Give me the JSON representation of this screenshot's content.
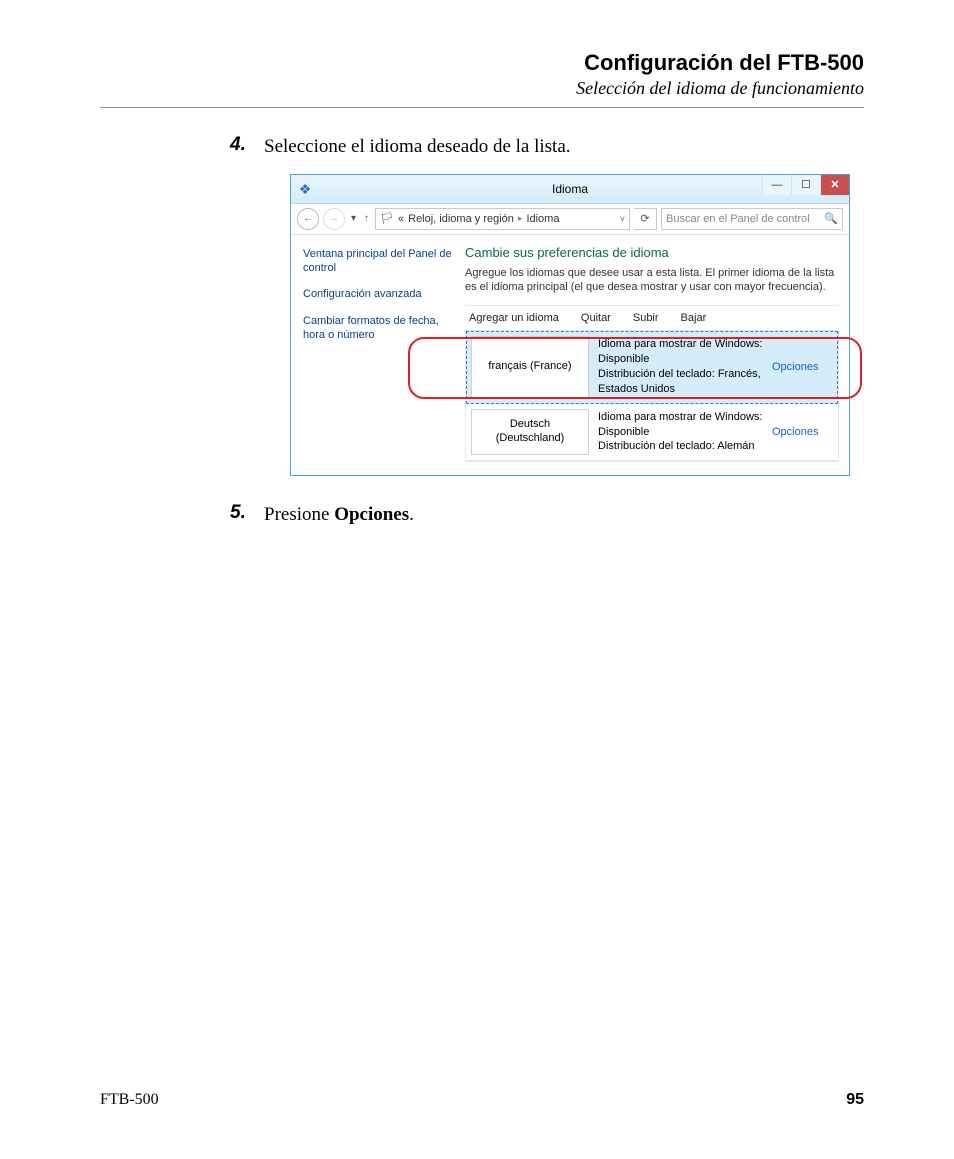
{
  "header": {
    "title": "Configuración del FTB-500",
    "subtitle": "Selección del idioma de funcionamiento"
  },
  "steps": {
    "s4_num": "4.",
    "s4_text": "Seleccione el idioma deseado de la lista.",
    "s5_num": "5.",
    "s5_text_pre": "Presione ",
    "s5_text_bold": "Opciones",
    "s5_text_post": "."
  },
  "win": {
    "title": "Idioma",
    "addr": {
      "crumb_prefix": "«",
      "crumb1": "Reloj, idioma y región",
      "crumb2": "Idioma"
    },
    "search_placeholder": "Buscar en el Panel de control",
    "sidebar": {
      "link1": "Ventana principal del Panel de control",
      "link2": "Configuración avanzada",
      "link3": "Cambiar formatos de fecha, hora o número"
    },
    "main": {
      "title": "Cambie sus preferencias de idioma",
      "desc": "Agregue los idiomas que desee usar a esta lista. El primer idioma de la lista es el idioma principal (el que desea mostrar y usar con mayor frecuencia).",
      "toolbar": {
        "add": "Agregar un idioma",
        "remove": "Quitar",
        "up": "Subir",
        "down": "Bajar"
      },
      "rows": [
        {
          "name": "français (France)",
          "info": "Idioma para mostrar de Windows: Disponible\nDistribución del teclado: Francés, Estados Unidos",
          "options": "Opciones"
        },
        {
          "name": "Deutsch (Deutschland)",
          "info": "Idioma para mostrar de Windows: Disponible\nDistribución del teclado: Alemán",
          "options": "Opciones"
        }
      ]
    }
  },
  "footer": {
    "model": "FTB-500",
    "page": "95"
  }
}
